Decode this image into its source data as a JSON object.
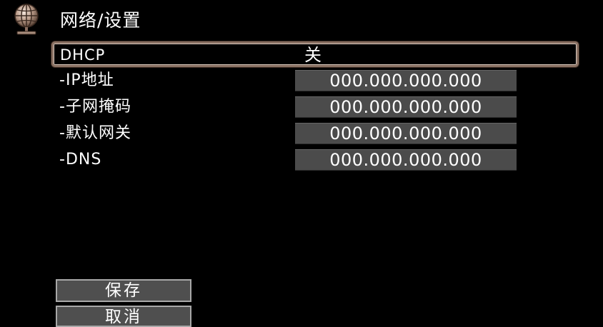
{
  "header": {
    "icon": "globe-network-icon",
    "title": "网络/设置"
  },
  "dhcp": {
    "label": "DHCP",
    "value": "关"
  },
  "fields": {
    "ip": {
      "label": "-IP地址",
      "value": "000.000.000.000"
    },
    "subnet_mask": {
      "label": "-子网掩码",
      "value": "000.000.000.000"
    },
    "gateway": {
      "label": "-默认网关",
      "value": "000.000.000.000"
    },
    "dns": {
      "label": "-DNS",
      "value": "000.000.000.000"
    }
  },
  "buttons": {
    "save_label": "保存",
    "cancel_label": "取消"
  },
  "colors": {
    "background": "#000000",
    "field_fill": "#4b4b4b",
    "selection_border": "#8a7163",
    "button_fill": "#4f4f4f",
    "button_border": "#a8a8a8"
  }
}
